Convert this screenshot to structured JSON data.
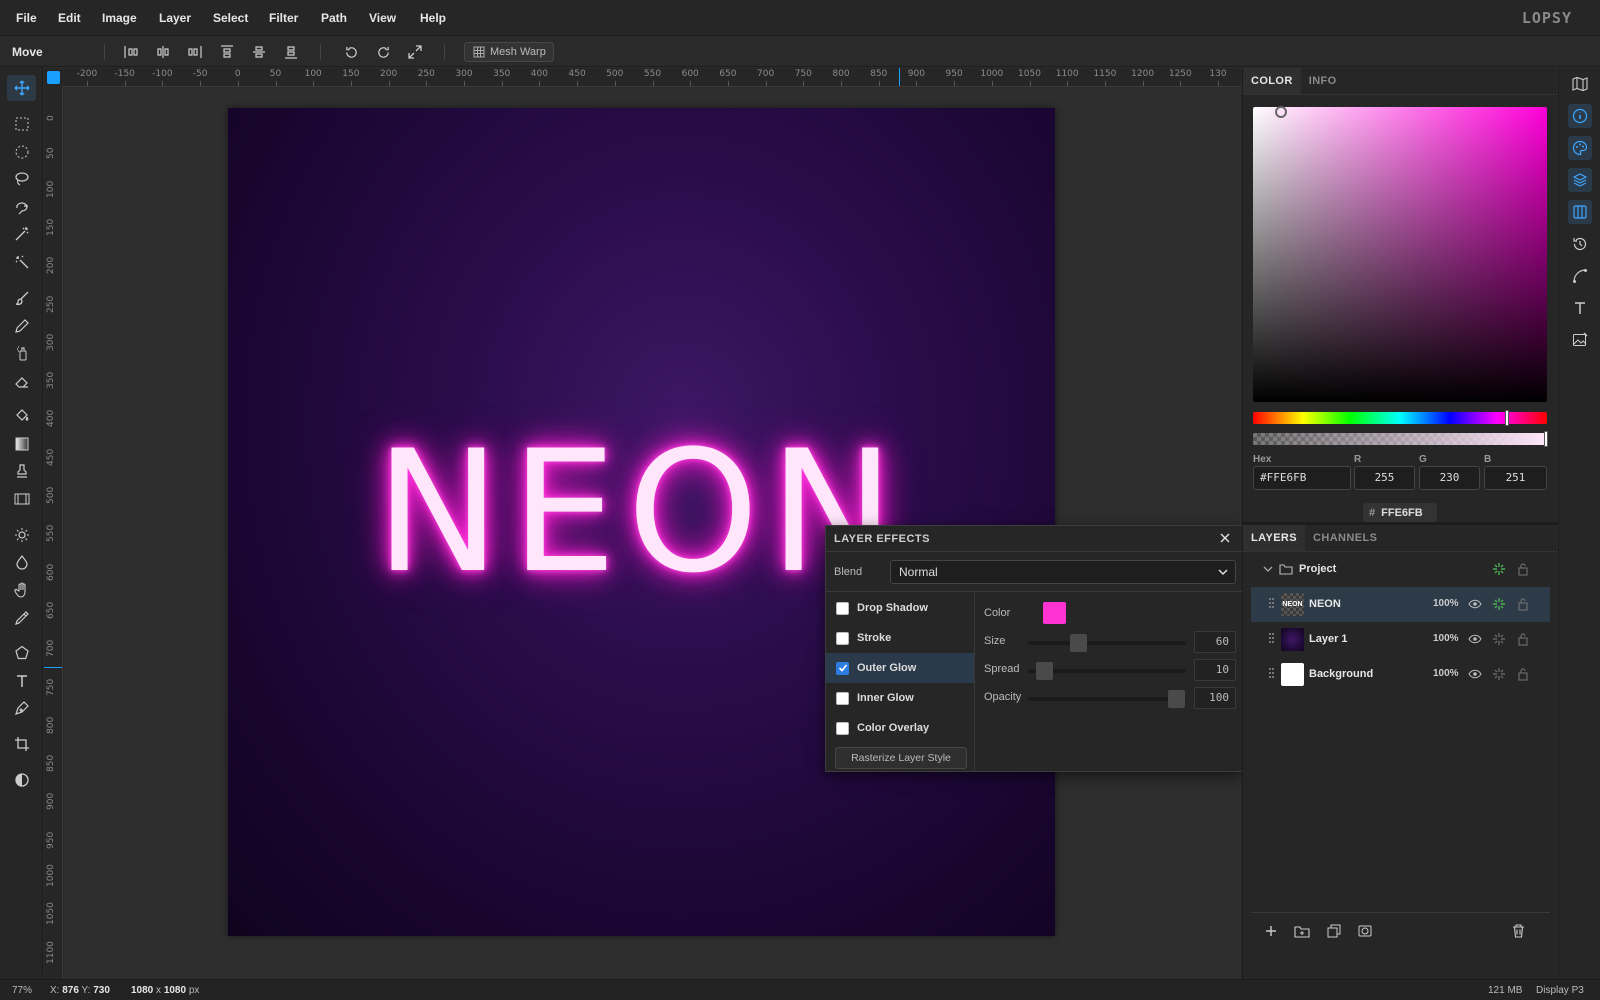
{
  "app": {
    "logo": "LOPSY"
  },
  "menu": [
    "File",
    "Edit",
    "Image",
    "Layer",
    "Select",
    "Filter",
    "Path",
    "View",
    "Help"
  ],
  "tool_options": {
    "tool_name": "Move",
    "mesh_warp_label": "Mesh Warp",
    "icons": [
      "align-left-icon",
      "align-center-h-icon",
      "align-right-icon",
      "align-top-icon",
      "align-middle-v-icon",
      "align-bottom-icon",
      "rotate-ccw-icon",
      "rotate-cw-icon",
      "expand-icon"
    ]
  },
  "toolbar": {
    "active": "move-tool",
    "tools": [
      "move-tool",
      "rect-select-tool",
      "ellipse-select-tool",
      "lasso-tool",
      "magnetic-lasso-tool",
      "magic-wand-tool",
      "quick-select-tool",
      "brush-tool",
      "pencil-tool",
      "spray-tool",
      "eraser-tool",
      "bucket-tool",
      "gradient-tool",
      "stamp-tool",
      "film-tool",
      "dodge-tool",
      "burn-tool",
      "hand-tool",
      "eyedropper-tool",
      "polygon-tool",
      "text-tool",
      "pen-tool",
      "crop-tool",
      "contrast-tool"
    ]
  },
  "rulers": {
    "h_labels": [
      "-200",
      "-150",
      "-100",
      "-50",
      "0",
      "50",
      "100",
      "150",
      "200",
      "250",
      "300",
      "350",
      "400",
      "450",
      "500",
      "550",
      "600",
      "650",
      "700",
      "750",
      "800",
      "850",
      "900",
      "950",
      "1000",
      "1050",
      "1100",
      "1150",
      "1200",
      "1250",
      "130"
    ],
    "v_labels": [
      "0",
      "50",
      "100",
      "150",
      "200",
      "250",
      "300",
      "350",
      "400",
      "450",
      "500",
      "550",
      "600",
      "650",
      "700",
      "750",
      "800",
      "850",
      "900",
      "950",
      "1000",
      "1050",
      "1100"
    ]
  },
  "canvas": {
    "text": "NEON",
    "text_color": "#ffe6fb",
    "glow_color": "#ff2ad7"
  },
  "layer_effects": {
    "title": "LAYER EFFECTS",
    "blend_label": "Blend",
    "blend_value": "Normal",
    "effects": [
      {
        "label": "Drop Shadow",
        "checked": false
      },
      {
        "label": "Stroke",
        "checked": false
      },
      {
        "label": "Outer Glow",
        "checked": true
      },
      {
        "label": "Inner Glow",
        "checked": false
      },
      {
        "label": "Color Overlay",
        "checked": false
      }
    ],
    "rasterize_label": "Rasterize Layer Style",
    "props": {
      "color_label": "Color",
      "color_value": "#ff33d2",
      "size_label": "Size",
      "size_value": "60",
      "spread_label": "Spread",
      "spread_value": "10",
      "opacity_label": "Opacity",
      "opacity_value": "100"
    }
  },
  "color_panel": {
    "tabs": [
      "COLOR",
      "INFO"
    ],
    "active_tab": "COLOR",
    "hue_color": "#ff00d8",
    "hex_label": "Hex",
    "hex_value": "#FFE6FB",
    "r_label": "R",
    "r_value": "255",
    "g_label": "G",
    "g_value": "230",
    "b_label": "B",
    "b_value": "251",
    "hex_pill": "FFE6FB"
  },
  "layers_panel": {
    "tabs": [
      "LAYERS",
      "CHANNELS"
    ],
    "active_tab": "LAYERS",
    "group": {
      "name": "Project"
    },
    "layers": [
      {
        "name": "NEON",
        "opacity": "100%",
        "selected": true
      },
      {
        "name": "Layer 1",
        "opacity": "100%",
        "selected": false
      },
      {
        "name": "Background",
        "opacity": "100%",
        "selected": false
      }
    ],
    "footer_icons": [
      "add-layer-icon",
      "new-group-icon",
      "duplicate-layer-icon",
      "mask-icon",
      "delete-layer-icon"
    ]
  },
  "right_strip": [
    "map-icon",
    "info-icon",
    "palette-icon",
    "layers-icon",
    "columns-icon",
    "history-icon",
    "path-icon",
    "type-icon",
    "image-edit-icon"
  ],
  "status": {
    "zoom": "77%",
    "x_label": "X:",
    "x": "876",
    "y_label": "Y:",
    "y": "730",
    "doc_w": "1080",
    "doc_h": "1080",
    "unit": "px",
    "memory": "121 MB",
    "color_profile": "Display P3"
  }
}
